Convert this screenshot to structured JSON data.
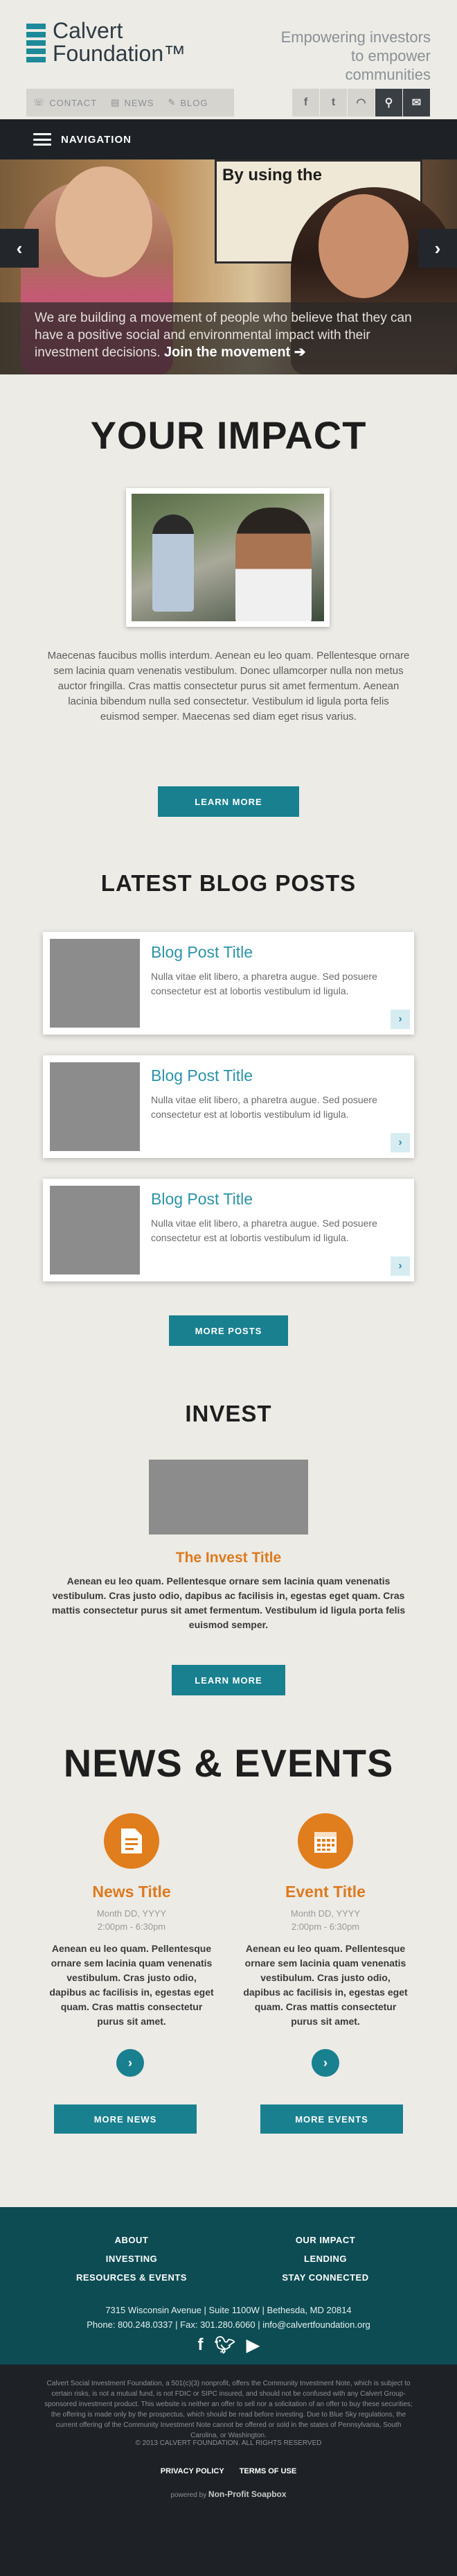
{
  "header": {
    "logo": {
      "line1": "Calvert",
      "line2": "Foundation™"
    },
    "tagline": "Empowering investors to empower communities",
    "links": [
      {
        "label": "CONTACT"
      },
      {
        "label": "NEWS"
      },
      {
        "label": "BLOG"
      }
    ],
    "social": [
      "f",
      "t",
      "rss",
      "search",
      "mail"
    ]
  },
  "navigation": {
    "label": "NAVIGATION"
  },
  "hero": {
    "board_text": "By using the",
    "text": "We are building a movement of people who believe that they can have a positive social and environmental impact with their investment decisions.",
    "cta": "Join the movement ➔"
  },
  "impact": {
    "title": "YOUR IMPACT",
    "body": "Maecenas faucibus mollis interdum. Aenean eu leo quam. Pellentesque ornare sem lacinia quam venenatis vestibulum. Donec ullamcorper nulla non metus auctor fringilla. Cras mattis consectetur purus sit amet fermentum. Aenean lacinia bibendum nulla sed consectetur. Vestibulum id ligula porta felis euismod semper. Maecenas sed diam eget risus varius.",
    "button": "LEARN MORE"
  },
  "blog": {
    "title": "LATEST BLOG POSTS",
    "posts": [
      {
        "title": "Blog Post Title",
        "text": "Nulla vitae elit libero, a pharetra augue. Sed posuere consectetur est at lobortis vestibulum id ligula."
      },
      {
        "title": "Blog Post Title",
        "text": "Nulla vitae elit libero, a pharetra augue. Sed posuere consectetur est at lobortis vestibulum id ligula."
      },
      {
        "title": "Blog Post Title",
        "text": "Nulla vitae elit libero, a pharetra augue. Sed posuere consectetur est at lobortis vestibulum id ligula."
      }
    ],
    "button": "MORE POSTS"
  },
  "invest": {
    "title": "INVEST",
    "subtitle": "The Invest Title",
    "body": "Aenean eu leo quam. Pellentesque ornare sem lacinia quam venenatis vestibulum. Cras justo odio, dapibus ac facilisis in, egestas eget quam. Cras mattis consectetur purus sit amet fermentum. Vestibulum id ligula porta felis euismod semper.",
    "button": "LEARN MORE"
  },
  "news_events": {
    "title": "NEWS & EVENTS",
    "news": {
      "title": "News Title",
      "date": "Month DD, YYYY",
      "time": "2:00pm - 6:30pm",
      "text": "Aenean eu leo quam. Pellentesque ornare sem lacinia quam venenatis vestibulum. Cras justo odio, dapibus ac facilisis in, egestas eget quam. Cras mattis consectetur purus sit amet.",
      "button": "MORE NEWS"
    },
    "event": {
      "title": "Event Title",
      "date": "Month DD, YYYY",
      "time": "2:00pm - 6:30pm",
      "text": "Aenean eu leo quam. Pellentesque ornare sem lacinia quam venenatis vestibulum. Cras justo odio, dapibus ac facilisis in, egestas eget quam. Cras mattis consectetur purus sit amet.",
      "button": "MORE EVENTS"
    }
  },
  "footer": {
    "left": [
      "ABOUT",
      "INVESTING",
      "RESOURCES & EVENTS"
    ],
    "right": [
      "OUR IMPACT",
      "LENDING",
      "STAY CONNECTED"
    ],
    "address": "7315 Wisconsin Avenue  |  Suite 1100W  |  Bethesda, MD 20814",
    "contact": "Phone: 800.248.0337  |  Fax: 301.280.6060  |  info@calvertfoundation.org"
  },
  "legal": {
    "text": "Calvert Social Investment Foundation, a 501(c)(3) nonprofit, offers the Community Investment Note, which is subject to certain risks, is not a mutual fund, is not FDIC or SIPC insured, and should not be confused with any Calvert Group-sponsored investment product. This website is neither an offer to sell nor a solicitation of an offer to buy these securities; the offering is made only by the prospectus, which should be read before investing. Due to Blue Sky regulations, the current offering of the Community Investment Note cannot be offered or sold in the states of Pennsylvania, South Carolina, or Washington.",
    "copyright": "© 2013 CALVERT FOUNDATION. ALL RIGHTS RESERVED",
    "links": [
      "PRIVACY POLICY",
      "TERMS OF USE"
    ],
    "powered_prefix": "powered by",
    "powered_brand": "Non-Profit Soapbox"
  }
}
